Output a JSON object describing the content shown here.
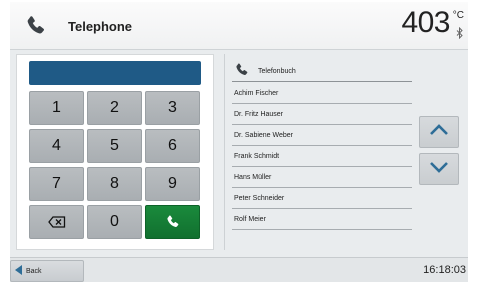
{
  "header": {
    "title": "Telephone",
    "temperature": "403",
    "temperature_unit": "°C"
  },
  "keypad": {
    "display_value": "",
    "keys": [
      "1",
      "2",
      "3",
      "4",
      "5",
      "6",
      "7",
      "8",
      "9",
      "0"
    ]
  },
  "phonebook": {
    "title": "Telefonbuch",
    "contacts": [
      "Achim Fischer",
      "Dr. Fritz Hauser",
      "Dr. Sabiene Weber",
      "Frank Schmidt",
      "Hans Müller",
      "Peter Schneider",
      "Rolf Meier"
    ]
  },
  "footer": {
    "back_label": "Back",
    "time": "16:18:03"
  },
  "colors": {
    "display": "#1f5a86",
    "call_button": "#1a8a3c",
    "arrow": "#2e6d97"
  },
  "icons": {
    "header": "phone-icon",
    "status": "bluetooth-icon",
    "delete": "backspace-icon",
    "call": "phone-icon",
    "scroll_up": "chevron-up-icon",
    "scroll_down": "chevron-down-icon",
    "back": "triangle-left-icon"
  }
}
